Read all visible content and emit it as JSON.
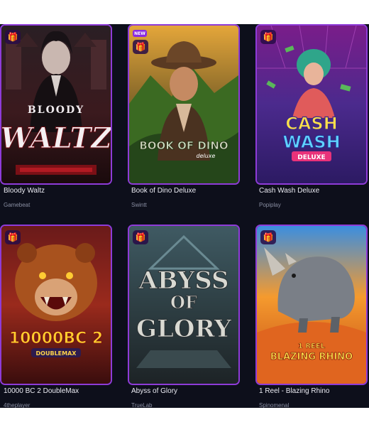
{
  "accent_color": "#8e3bd8",
  "background_color": "#0d0f1b",
  "badge_icon": "gift-icon",
  "games": [
    {
      "title": "Bloody Waltz",
      "provider": "Gamebeat",
      "art_text_line1": "BLOODY",
      "art_text_line2": "WALTZ",
      "new_badge": ""
    },
    {
      "title": "Book of Dino Deluxe",
      "provider": "Swintt",
      "art_text_line1": "BOOK OF DINO",
      "art_text_line2": "deluxe",
      "new_badge": "NEW"
    },
    {
      "title": "Cash Wash Deluxe",
      "provider": "Popiplay",
      "art_text_line1": "CASH",
      "art_text_line2": "WASH",
      "art_text_line3": "DELUXE",
      "new_badge": ""
    },
    {
      "title": "10000 BC 2 DoubleMax",
      "provider": "4theplayer",
      "art_text_line1": "10000BC 2",
      "art_text_line2": "DOUBLEMAX",
      "new_badge": ""
    },
    {
      "title": "Abyss of Glory",
      "provider": "TrueLab",
      "art_text_line1": "ABYSS",
      "art_text_line2": "OF",
      "art_text_line3": "GLORY",
      "new_badge": ""
    },
    {
      "title": "1 Reel - Blazing Rhino",
      "provider": "Spinomenal",
      "art_text_line1": "1 REEL",
      "art_text_line2": "BLAZING RHINO",
      "new_badge": ""
    }
  ]
}
